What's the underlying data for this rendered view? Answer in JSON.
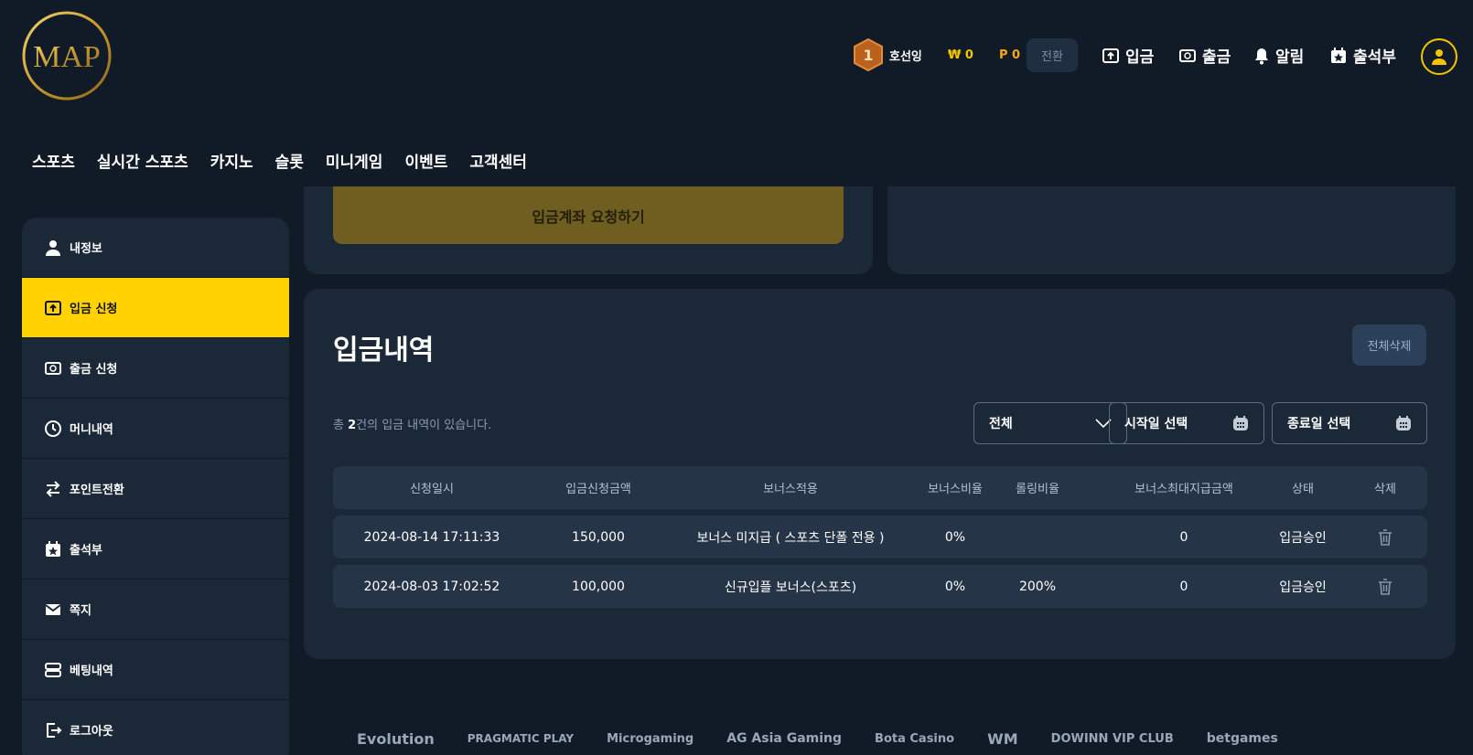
{
  "header": {
    "logo_text": "MAP",
    "username": "호선잉",
    "rank_number": "1",
    "balance": "₩ 0",
    "points": "P 0",
    "convert_label": "전환",
    "deposit_label": "입금",
    "withdraw_label": "출금",
    "alert_label": "알림",
    "attendance_label": "출석부"
  },
  "mainnav": [
    "스포츠",
    "실시간 스포츠",
    "카지노",
    "슬롯",
    "미니게임",
    "이벤트",
    "고객센터"
  ],
  "sidebar": {
    "items": [
      {
        "label": "내정보",
        "icon": "person-icon"
      },
      {
        "label": "입금 신청",
        "icon": "deposit-icon"
      },
      {
        "label": "출금 신청",
        "icon": "withdraw-icon"
      },
      {
        "label": "머니내역",
        "icon": "clock-icon"
      },
      {
        "label": "포인트전환",
        "icon": "exchange-icon"
      },
      {
        "label": "출석부",
        "icon": "calendar-star-icon"
      },
      {
        "label": "쪽지",
        "icon": "envelope-icon"
      },
      {
        "label": "베팅내역",
        "icon": "list-icon"
      },
      {
        "label": "로그아웃",
        "icon": "logout-icon"
      }
    ]
  },
  "request_button": "입금계좌 요청하기",
  "history": {
    "title": "입금내역",
    "delete_all": "전체삭제",
    "count_prefix": "총 ",
    "count": "2",
    "count_suffix": "건의 입금 내역이 있습니다.",
    "filter_select": "전체",
    "start_date": "시작일 선택",
    "end_date": "종료일 선택",
    "columns": [
      "신청일시",
      "입금신청금액",
      "보너스적용",
      "보너스비율",
      "롤링비율",
      "보너스최대지급금액",
      "상태",
      "삭제"
    ],
    "rows": [
      {
        "date": "2024-08-14 17:11:33",
        "amount": "150,000",
        "bonus": "보너스 미지급 ( 스포츠 단폴 전용 )",
        "bonus_rate": "0%",
        "rolling": "",
        "max_bonus": "0",
        "status": "입금승인"
      },
      {
        "date": "2024-08-03 17:02:52",
        "amount": "100,000",
        "bonus": "신규입플 보너스(스포츠)",
        "bonus_rate": "0%",
        "rolling": "200%",
        "max_bonus": "0",
        "status": "입금승인"
      }
    ]
  },
  "providers": [
    "Evolution",
    "PRAGMATIC PLAY",
    "Microgaming",
    "AG Asia Gaming",
    "Bota Casino",
    "WM",
    "DOWINN VIP CLUB",
    "betgames",
    ""
  ],
  "colors": {
    "accent": "#ffd200",
    "background": "#111b27",
    "panel": "#1b2838"
  }
}
